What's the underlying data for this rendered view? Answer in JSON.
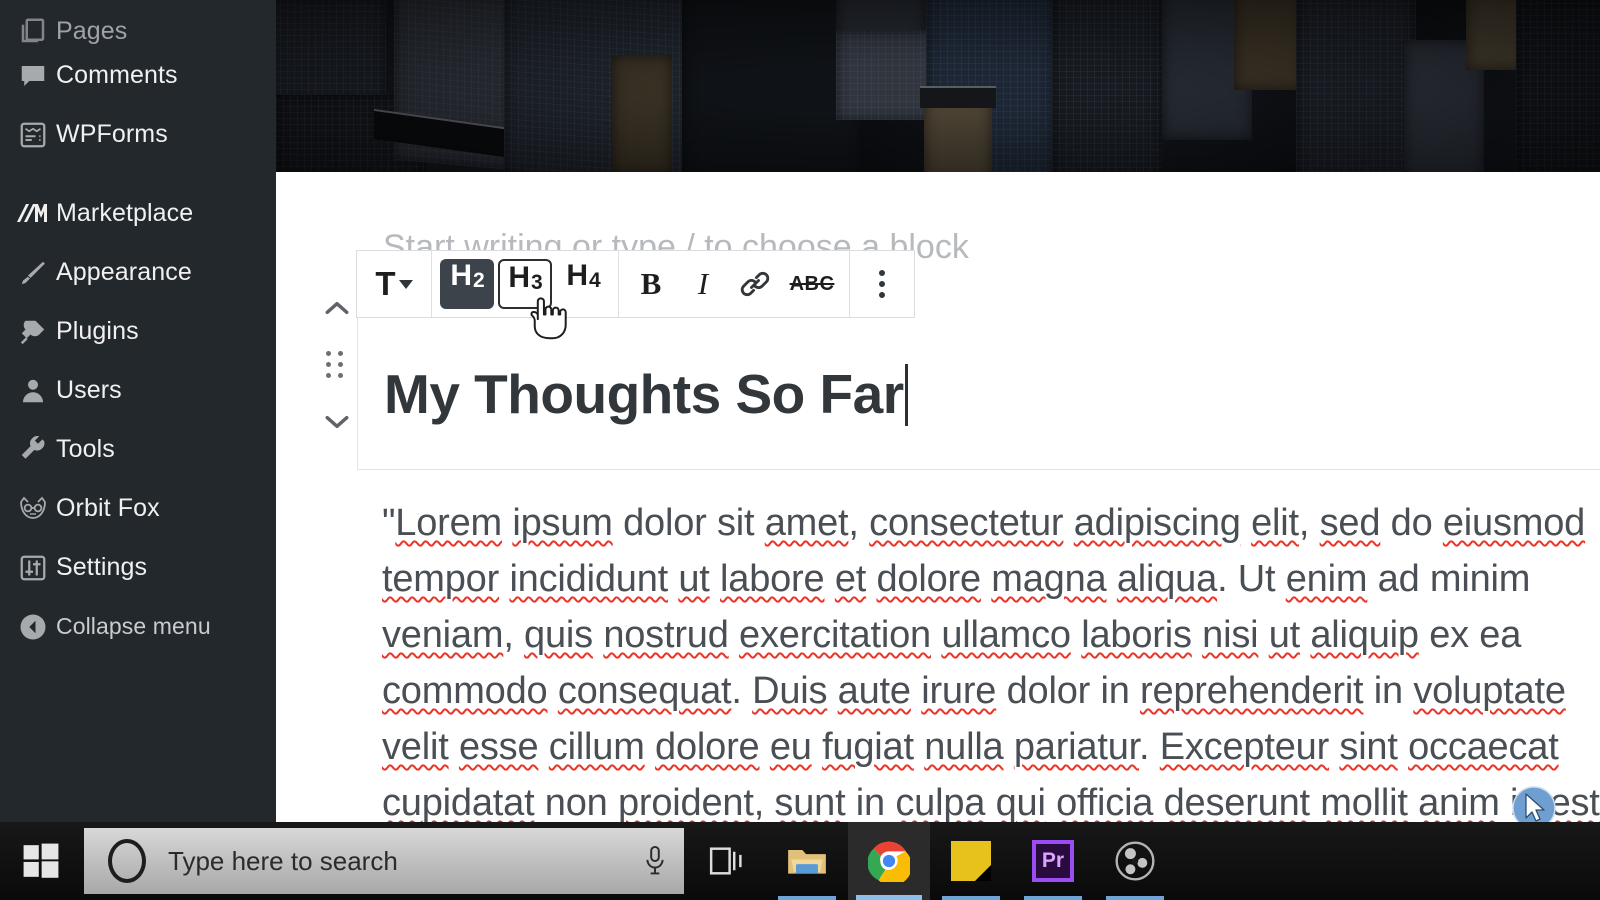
{
  "sidebar": {
    "items": [
      {
        "label": "Pages",
        "icon": "pages-icon",
        "dim": true
      },
      {
        "label": "Comments",
        "icon": "comments-icon",
        "dim": false
      },
      {
        "label": "WPForms",
        "icon": "wpforms-icon",
        "dim": false
      },
      {
        "label": "Marketplace",
        "icon": "marketplace-icon",
        "dim": false
      },
      {
        "label": "Appearance",
        "icon": "paintbrush-icon",
        "dim": false
      },
      {
        "label": "Plugins",
        "icon": "plug-icon",
        "dim": false
      },
      {
        "label": "Users",
        "icon": "user-icon",
        "dim": false
      },
      {
        "label": "Tools",
        "icon": "wrench-icon",
        "dim": false
      },
      {
        "label": "Orbit Fox",
        "icon": "orbitfox-icon",
        "dim": false
      },
      {
        "label": "Settings",
        "icon": "sliders-icon",
        "dim": false
      }
    ],
    "collapse_label": "Collapse menu",
    "background_color": "#23282d",
    "text_color": "#f0f0f1"
  },
  "toolbar": {
    "paragraph_label": "T",
    "headings": [
      {
        "label": "H",
        "level": "2",
        "state": "active"
      },
      {
        "label": "H",
        "level": "3",
        "state": "hover"
      },
      {
        "label": "H",
        "level": "4",
        "state": "default"
      }
    ],
    "bold_label": "B",
    "italic_label": "I",
    "link_label": "link-icon",
    "strikethrough_label": "ABC",
    "more_label": "more-options-icon",
    "active_bg": "#3c434a",
    "active_fg": "#ffffff"
  },
  "gutter": {
    "move_up_label": "move-up",
    "drag_label": "drag-handle",
    "move_down_label": "move-down"
  },
  "editor": {
    "heading_text": "My Thoughts So Far",
    "heading_color": "#32373c",
    "placeholder_peek": "Start writing or type / to choose a block",
    "body_paragraph": "\"Lorem ipsum dolor sit amet, consectetur adipiscing elit, sed do eiusmod tempor incididunt ut labore et dolore magna aliqua. Ut enim ad minim veniam, quis nostrud exercitation ullamco laboris nisi ut aliquip ex ea commodo consequat. Duis aute irure dolor in reprehenderit in voluptate velit esse cillum dolore eu fugiat nulla pariatur. Excepteur sint occaecat cupidatat non proident, sunt in culpa qui officia deserunt mollit anim id est laborum.\"",
    "spellcheck_color": "#e8352a",
    "body_color": "#4a4f55"
  },
  "taskbar": {
    "start_label": "start-button",
    "search_placeholder": "Type here to search",
    "search_value": "",
    "cortana_label": "cortana-icon",
    "microphone_label": "microphone-icon",
    "apps": [
      {
        "name": "task-view",
        "label": "Task View",
        "active": false
      },
      {
        "name": "file-explorer",
        "label": "File Explorer",
        "active": false
      },
      {
        "name": "google-chrome",
        "label": "Google Chrome",
        "active": true
      },
      {
        "name": "sticky-notes",
        "label": "Sticky Notes",
        "active": false
      },
      {
        "name": "premiere-pro",
        "label": "Pr",
        "active": false
      },
      {
        "name": "obs-studio",
        "label": "OBS Studio",
        "active": false
      }
    ]
  }
}
